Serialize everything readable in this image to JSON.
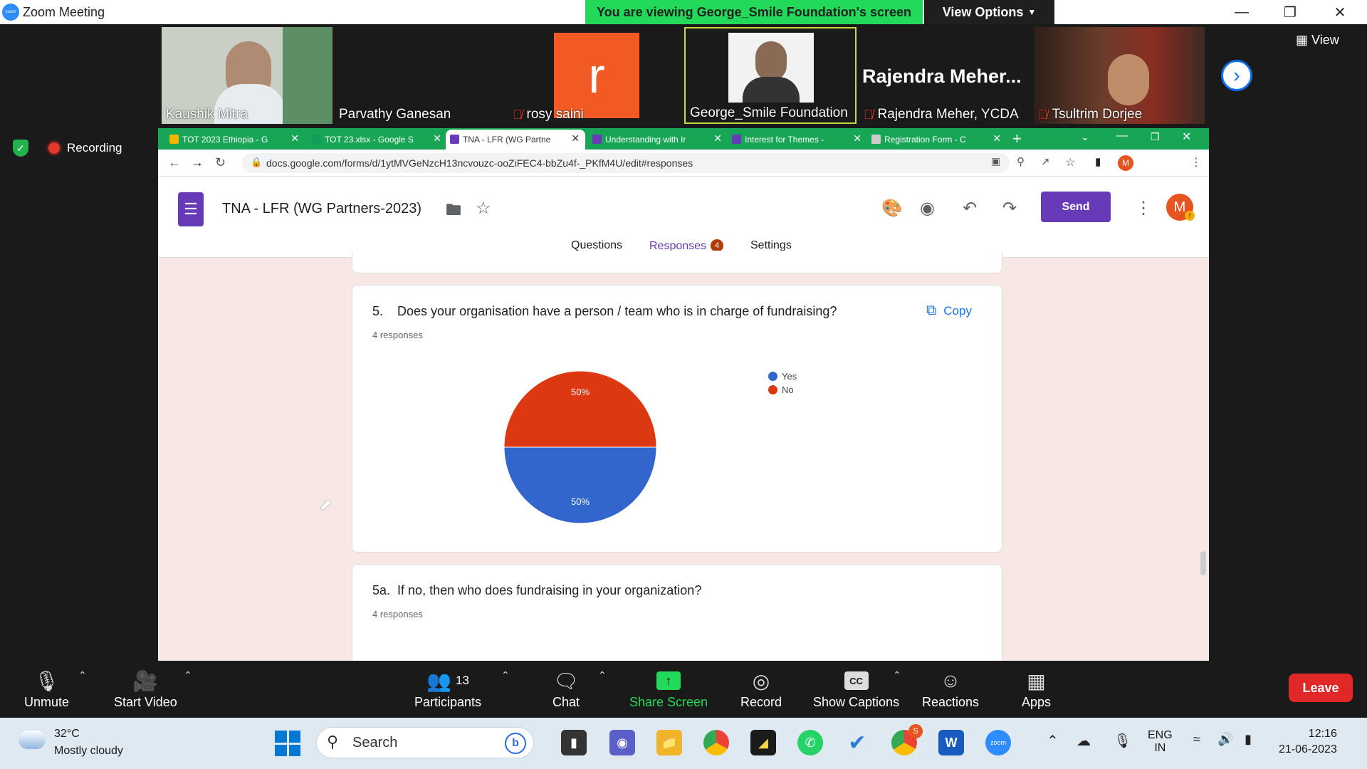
{
  "zoom": {
    "window_title": "Zoom Meeting",
    "banner": "You are viewing George_Smile Foundation's screen",
    "view_options": "View Options",
    "view": "View",
    "recording": "Recording",
    "participants": [
      {
        "name": "Kaushik Mitra",
        "muted": false
      },
      {
        "name": "Parvathy Ganesan",
        "muted": false
      },
      {
        "name": "rosy saini",
        "muted": true,
        "initial": "r"
      },
      {
        "name": "George_Smile Foundation",
        "muted": false
      },
      {
        "name": "Rajendra Meher, YCDA",
        "muted": true,
        "big_label": "Rajendra  Meher..."
      },
      {
        "name": "Tsultrim Dorjee",
        "muted": true
      }
    ]
  },
  "browser": {
    "tabs": [
      {
        "label": "TOT 2023 Ethiopia - G",
        "color": "#f4b400"
      },
      {
        "label": "TOT 23.xlsx - Google S",
        "color": "#0f9d58"
      },
      {
        "label": "TNA - LFR (WG Partne",
        "color": "#673ab7"
      },
      {
        "label": "Understanding with Ir",
        "color": "#673ab7"
      },
      {
        "label": "Interest for Themes -",
        "color": "#673ab7"
      },
      {
        "label": "Registration Form - C",
        "color": "#cccccc"
      }
    ],
    "url": "docs.google.com/forms/d/1ytMVGeNzcH13ncvouzc-ooZiFEC4-bbZu4f-_PKfM4U/edit#responses",
    "profile_initial": "M"
  },
  "form": {
    "title": "TNA - LFR (WG Partners-2023)",
    "send_label": "Send",
    "account_initial": "M",
    "tabs": {
      "questions": "Questions",
      "responses": "Responses",
      "responses_count": "4",
      "settings": "Settings"
    },
    "q5": {
      "number": "5.",
      "text": "Does your organisation have a person / team who is in charge of fundraising?",
      "responses": "4 responses",
      "copy_label": "Copy"
    },
    "q5a": {
      "number": "5a.",
      "text": "If no, then who does fundraising in your organization?",
      "responses": "4 responses"
    }
  },
  "chart_data": {
    "type": "pie",
    "categories": [
      "Yes",
      "No"
    ],
    "values": [
      50,
      50
    ],
    "labels": [
      "50%",
      "50%"
    ],
    "colors": [
      "#3366cc",
      "#dc3912"
    ],
    "legend": "right"
  },
  "toolbar": {
    "unmute": "Unmute",
    "start_video": "Start Video",
    "participants": "Participants",
    "participants_count": "13",
    "chat": "Chat",
    "share_screen": "Share Screen",
    "record": "Record",
    "show_captions": "Show Captions",
    "captions_glyph": "CC",
    "reactions": "Reactions",
    "apps": "Apps",
    "leave": "Leave"
  },
  "taskbar": {
    "temperature": "32°C",
    "weather": "Mostly cloudy",
    "search_placeholder": "Search",
    "language": "ENG",
    "region": "IN",
    "time": "12:16",
    "date": "21-06-2023",
    "chrome_badge": "S"
  }
}
